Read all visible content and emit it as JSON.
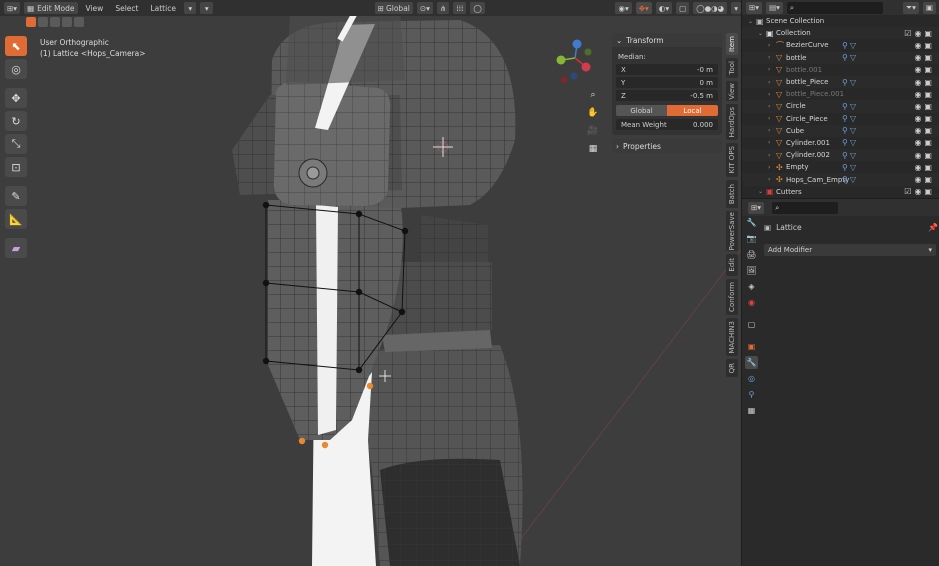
{
  "header": {
    "mode": "Edit Mode",
    "menus": [
      "View",
      "Select",
      "Lattice"
    ],
    "orientation": "Global"
  },
  "viewport": {
    "view_label": "User Orthographic",
    "object_label": "(1) Lattice <Hops_Camera>"
  },
  "npanel": {
    "transform_title": "Transform",
    "median_label": "Median:",
    "fields": [
      {
        "label": "X",
        "value": "-0 m"
      },
      {
        "label": "Y",
        "value": "0 m"
      },
      {
        "label": "Z",
        "value": "-0.5 m"
      }
    ],
    "space_options": [
      "Global",
      "Local"
    ],
    "space_selected": "Local",
    "weight_label": "Mean Weight",
    "weight_value": "0.000",
    "properties_title": "Properties"
  },
  "sidebar_tabs": [
    "Item",
    "Tool",
    "View",
    "HardOps",
    "KIT OPS",
    "Batch",
    "PowerSave",
    "Edit",
    "Conform",
    "MACHIN3",
    "QR"
  ],
  "sidebar_active_tab": "Item",
  "outliner": {
    "rows": [
      {
        "label": "Scene Collection",
        "depth": 0,
        "icon": "scene-collection-icon",
        "dim": false
      },
      {
        "label": "Collection",
        "depth": 1,
        "icon": "collection-icon",
        "dim": false
      },
      {
        "label": "BezierCurve",
        "depth": 2,
        "icon": "curve-icon",
        "dim": false
      },
      {
        "label": "bottle",
        "depth": 2,
        "icon": "mesh-icon",
        "dim": false
      },
      {
        "label": "bottle.001",
        "depth": 2,
        "icon": "mesh-icon",
        "dim": true
      },
      {
        "label": "bottle_Piece",
        "depth": 2,
        "icon": "mesh-icon",
        "dim": false
      },
      {
        "label": "bottle_Piece.001",
        "depth": 2,
        "icon": "mesh-icon",
        "dim": true
      },
      {
        "label": "Circle",
        "depth": 2,
        "icon": "mesh-icon",
        "dim": false
      },
      {
        "label": "Circle_Piece",
        "depth": 2,
        "icon": "mesh-icon",
        "dim": false
      },
      {
        "label": "Cube",
        "depth": 2,
        "icon": "mesh-icon",
        "dim": false
      },
      {
        "label": "Cylinder.001",
        "depth": 2,
        "icon": "mesh-icon",
        "dim": false
      },
      {
        "label": "Cylinder.002",
        "depth": 2,
        "icon": "mesh-icon",
        "dim": false
      },
      {
        "label": "Empty",
        "depth": 2,
        "icon": "empty-icon",
        "dim": false
      },
      {
        "label": "Hops_Cam_Empty",
        "depth": 2,
        "icon": "empty-icon",
        "dim": false
      },
      {
        "label": "Cutters",
        "depth": 1,
        "icon": "collection-icon",
        "dim": false
      }
    ]
  },
  "properties": {
    "object_name": "Lattice",
    "add_modifier_label": "Add Modifier"
  },
  "colors": {
    "accent": "#e06b35",
    "viewport_bg": "#3d3d3d",
    "panel_bg": "#2a2a2a"
  }
}
